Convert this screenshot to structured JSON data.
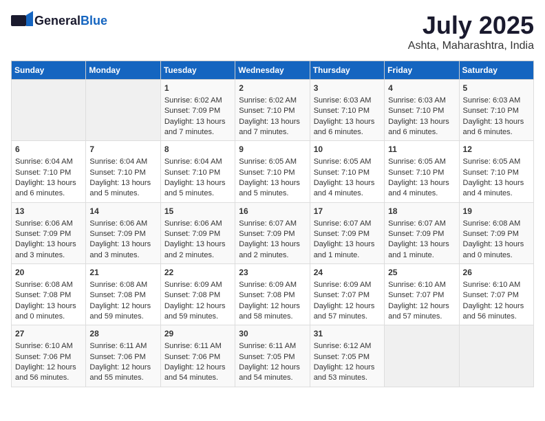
{
  "logo": {
    "line1": "General",
    "line2": "Blue"
  },
  "title": "July 2025",
  "subtitle": "Ashta, Maharashtra, India",
  "days_of_week": [
    "Sunday",
    "Monday",
    "Tuesday",
    "Wednesday",
    "Thursday",
    "Friday",
    "Saturday"
  ],
  "weeks": [
    [
      {
        "day": "",
        "info": ""
      },
      {
        "day": "",
        "info": ""
      },
      {
        "day": "1",
        "info": "Sunrise: 6:02 AM\nSunset: 7:09 PM\nDaylight: 13 hours\nand 7 minutes."
      },
      {
        "day": "2",
        "info": "Sunrise: 6:02 AM\nSunset: 7:10 PM\nDaylight: 13 hours\nand 7 minutes."
      },
      {
        "day": "3",
        "info": "Sunrise: 6:03 AM\nSunset: 7:10 PM\nDaylight: 13 hours\nand 6 minutes."
      },
      {
        "day": "4",
        "info": "Sunrise: 6:03 AM\nSunset: 7:10 PM\nDaylight: 13 hours\nand 6 minutes."
      },
      {
        "day": "5",
        "info": "Sunrise: 6:03 AM\nSunset: 7:10 PM\nDaylight: 13 hours\nand 6 minutes."
      }
    ],
    [
      {
        "day": "6",
        "info": "Sunrise: 6:04 AM\nSunset: 7:10 PM\nDaylight: 13 hours\nand 6 minutes."
      },
      {
        "day": "7",
        "info": "Sunrise: 6:04 AM\nSunset: 7:10 PM\nDaylight: 13 hours\nand 5 minutes."
      },
      {
        "day": "8",
        "info": "Sunrise: 6:04 AM\nSunset: 7:10 PM\nDaylight: 13 hours\nand 5 minutes."
      },
      {
        "day": "9",
        "info": "Sunrise: 6:05 AM\nSunset: 7:10 PM\nDaylight: 13 hours\nand 5 minutes."
      },
      {
        "day": "10",
        "info": "Sunrise: 6:05 AM\nSunset: 7:10 PM\nDaylight: 13 hours\nand 4 minutes."
      },
      {
        "day": "11",
        "info": "Sunrise: 6:05 AM\nSunset: 7:10 PM\nDaylight: 13 hours\nand 4 minutes."
      },
      {
        "day": "12",
        "info": "Sunrise: 6:05 AM\nSunset: 7:10 PM\nDaylight: 13 hours\nand 4 minutes."
      }
    ],
    [
      {
        "day": "13",
        "info": "Sunrise: 6:06 AM\nSunset: 7:09 PM\nDaylight: 13 hours\nand 3 minutes."
      },
      {
        "day": "14",
        "info": "Sunrise: 6:06 AM\nSunset: 7:09 PM\nDaylight: 13 hours\nand 3 minutes."
      },
      {
        "day": "15",
        "info": "Sunrise: 6:06 AM\nSunset: 7:09 PM\nDaylight: 13 hours\nand 2 minutes."
      },
      {
        "day": "16",
        "info": "Sunrise: 6:07 AM\nSunset: 7:09 PM\nDaylight: 13 hours\nand 2 minutes."
      },
      {
        "day": "17",
        "info": "Sunrise: 6:07 AM\nSunset: 7:09 PM\nDaylight: 13 hours\nand 1 minute."
      },
      {
        "day": "18",
        "info": "Sunrise: 6:07 AM\nSunset: 7:09 PM\nDaylight: 13 hours\nand 1 minute."
      },
      {
        "day": "19",
        "info": "Sunrise: 6:08 AM\nSunset: 7:09 PM\nDaylight: 13 hours\nand 0 minutes."
      }
    ],
    [
      {
        "day": "20",
        "info": "Sunrise: 6:08 AM\nSunset: 7:08 PM\nDaylight: 13 hours\nand 0 minutes."
      },
      {
        "day": "21",
        "info": "Sunrise: 6:08 AM\nSunset: 7:08 PM\nDaylight: 12 hours\nand 59 minutes."
      },
      {
        "day": "22",
        "info": "Sunrise: 6:09 AM\nSunset: 7:08 PM\nDaylight: 12 hours\nand 59 minutes."
      },
      {
        "day": "23",
        "info": "Sunrise: 6:09 AM\nSunset: 7:08 PM\nDaylight: 12 hours\nand 58 minutes."
      },
      {
        "day": "24",
        "info": "Sunrise: 6:09 AM\nSunset: 7:07 PM\nDaylight: 12 hours\nand 57 minutes."
      },
      {
        "day": "25",
        "info": "Sunrise: 6:10 AM\nSunset: 7:07 PM\nDaylight: 12 hours\nand 57 minutes."
      },
      {
        "day": "26",
        "info": "Sunrise: 6:10 AM\nSunset: 7:07 PM\nDaylight: 12 hours\nand 56 minutes."
      }
    ],
    [
      {
        "day": "27",
        "info": "Sunrise: 6:10 AM\nSunset: 7:06 PM\nDaylight: 12 hours\nand 56 minutes."
      },
      {
        "day": "28",
        "info": "Sunrise: 6:11 AM\nSunset: 7:06 PM\nDaylight: 12 hours\nand 55 minutes."
      },
      {
        "day": "29",
        "info": "Sunrise: 6:11 AM\nSunset: 7:06 PM\nDaylight: 12 hours\nand 54 minutes."
      },
      {
        "day": "30",
        "info": "Sunrise: 6:11 AM\nSunset: 7:05 PM\nDaylight: 12 hours\nand 54 minutes."
      },
      {
        "day": "31",
        "info": "Sunrise: 6:12 AM\nSunset: 7:05 PM\nDaylight: 12 hours\nand 53 minutes."
      },
      {
        "day": "",
        "info": ""
      },
      {
        "day": "",
        "info": ""
      }
    ]
  ]
}
